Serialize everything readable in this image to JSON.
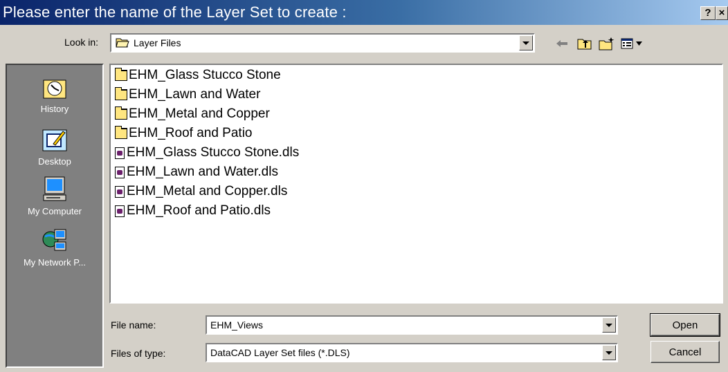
{
  "window": {
    "title": "Please enter the name of the Layer Set to create :",
    "help_label": "?",
    "close_label": "×"
  },
  "lookin": {
    "label": "Look in:",
    "value": "Layer Files",
    "icon": "folder-open-icon"
  },
  "toolbar": {
    "icons": [
      "back-arrow-icon",
      "up-folder-icon",
      "new-folder-icon",
      "view-menu-icon"
    ]
  },
  "places": [
    {
      "label": "History",
      "icon": "history-icon"
    },
    {
      "label": "Desktop",
      "icon": "desktop-icon"
    },
    {
      "label": "My Computer",
      "icon": "my-computer-icon"
    },
    {
      "label": "My Network P...",
      "icon": "network-places-icon"
    }
  ],
  "files": [
    {
      "name": "EHM_Glass Stucco Stone",
      "type": "folder"
    },
    {
      "name": "EHM_Lawn and Water",
      "type": "folder"
    },
    {
      "name": "EHM_Metal and Copper",
      "type": "folder"
    },
    {
      "name": "EHM_Roof and Patio",
      "type": "folder"
    },
    {
      "name": "EHM_Glass Stucco Stone.dls",
      "type": "file"
    },
    {
      "name": "EHM_Lawn and Water.dls",
      "type": "file"
    },
    {
      "name": "EHM_Metal and Copper.dls",
      "type": "file"
    },
    {
      "name": "EHM_Roof and Patio.dls",
      "type": "file"
    }
  ],
  "filename": {
    "label": "File name:",
    "value": "EHM_Views"
  },
  "filetype": {
    "label": "Files of type:",
    "value": "DataCAD Layer Set files (*.DLS)"
  },
  "buttons": {
    "open": "Open",
    "cancel": "Cancel"
  }
}
